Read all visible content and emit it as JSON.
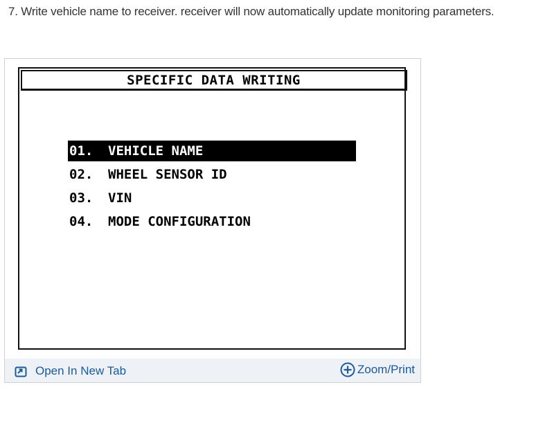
{
  "step": {
    "text": "7. Write vehicle name to receiver. receiver will now automatically update monitoring parameters."
  },
  "figure": {
    "screen": {
      "title": "SPECIFIC DATA WRITING",
      "menu": [
        {
          "number": "01.",
          "label": "VEHICLE NAME",
          "selected": true
        },
        {
          "number": "02.",
          "label": "WHEEL SENSOR ID",
          "selected": false
        },
        {
          "number": "03.",
          "label": "VIN",
          "selected": false
        },
        {
          "number": "04.",
          "label": "MODE CONFIGURATION",
          "selected": false
        }
      ]
    },
    "footer": {
      "open_tab_label": "Open In New Tab",
      "open_tab_icon": "open-in-new-tab-icon",
      "zoom_label": "Zoom/Print",
      "zoom_icon": "zoom-plus-icon"
    }
  },
  "colors": {
    "text": "#333333",
    "link": "#1a5a9c",
    "footer_bg": "#eef1f6"
  }
}
